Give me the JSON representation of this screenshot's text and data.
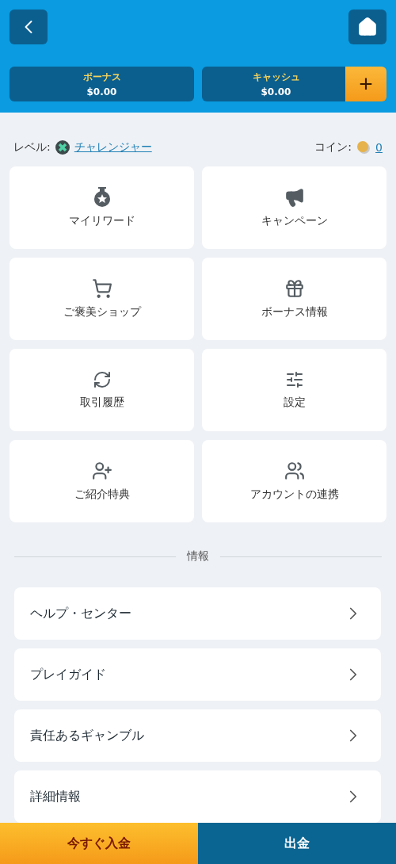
{
  "header": {
    "balances": [
      {
        "label": "ボーナス",
        "amount": "$0.00"
      },
      {
        "label": "キャッシュ",
        "amount": "$0.00"
      }
    ],
    "add_button": "+"
  },
  "level": {
    "label": "レベル:",
    "value": "チャレンジャー"
  },
  "coins": {
    "label": "コイン:",
    "value": "0"
  },
  "tiles": [
    {
      "label": "マイリワード"
    },
    {
      "label": "キャンペーン"
    },
    {
      "label": "ご褒美ショップ"
    },
    {
      "label": "ボーナス情報"
    },
    {
      "label": "取引履歴"
    },
    {
      "label": "設定"
    },
    {
      "label": "ご紹介特典"
    },
    {
      "label": "アカウントの連携"
    }
  ],
  "section_title": "情報",
  "links": [
    {
      "label": "ヘルプ・センター"
    },
    {
      "label": "プレイガイド"
    },
    {
      "label": "責任あるギャンブル"
    },
    {
      "label": "詳細情報"
    }
  ],
  "bottom_bar": {
    "deposit": "今すぐ入金",
    "withdraw": "出金"
  }
}
